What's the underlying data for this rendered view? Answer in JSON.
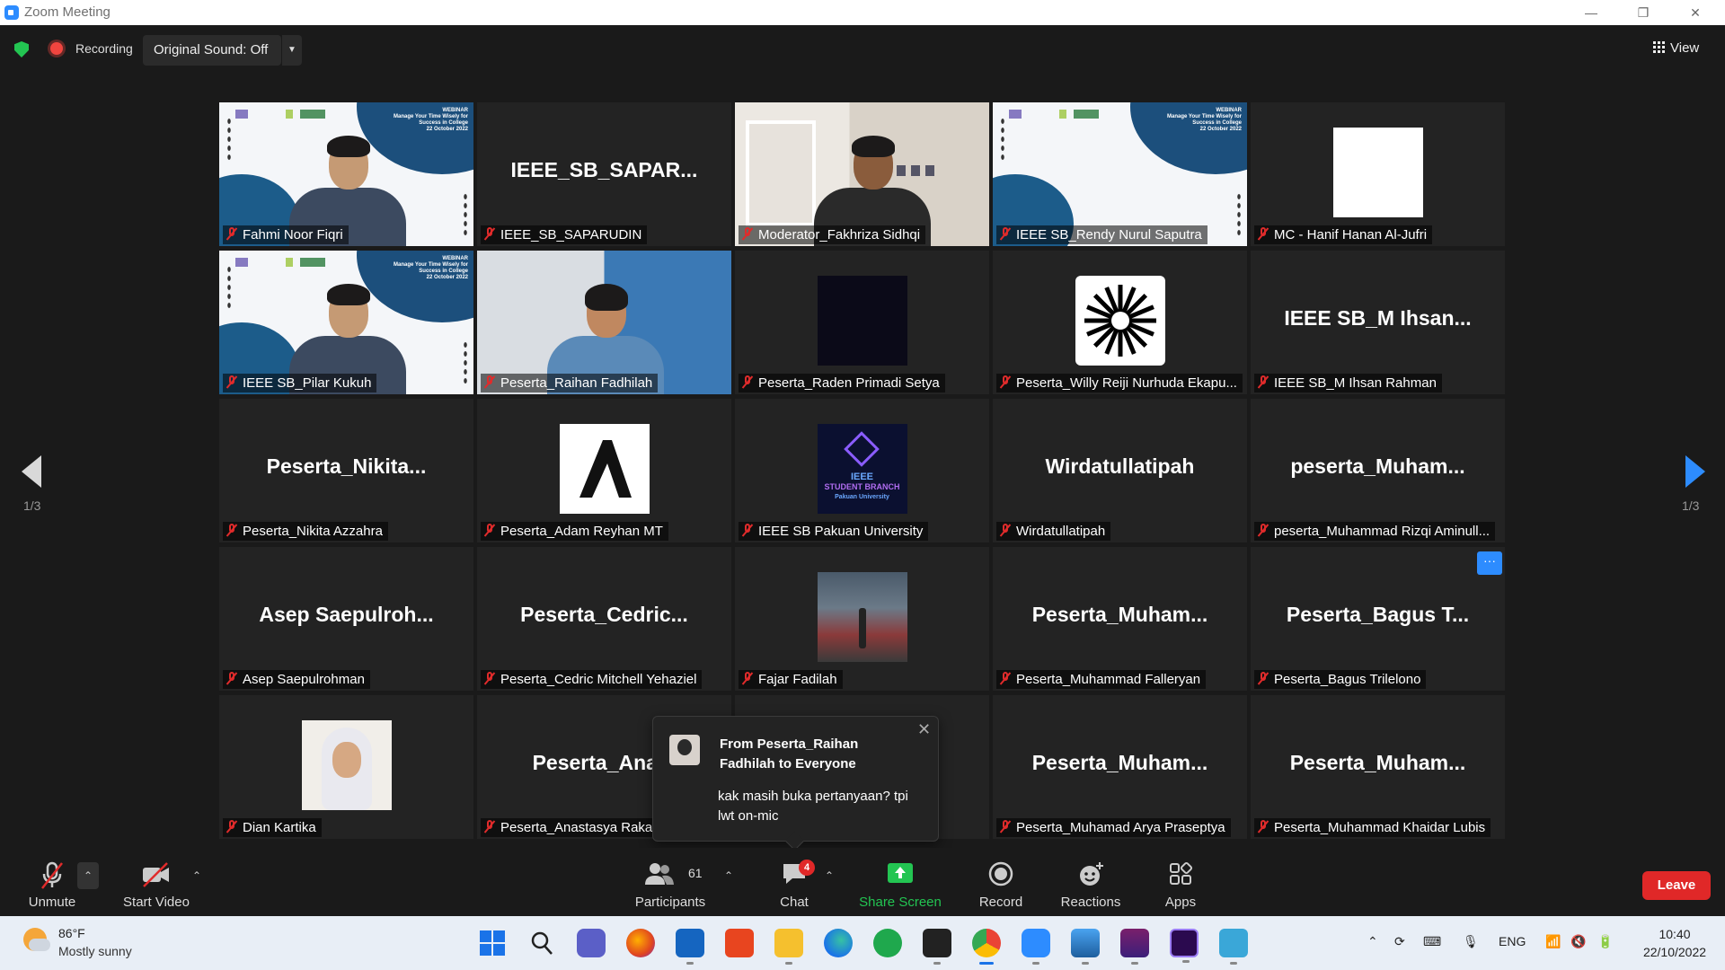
{
  "window": {
    "title": "Zoom Meeting"
  },
  "topbar": {
    "recording_label": "Recording",
    "original_sound_label": "Original Sound: Off",
    "view_label": "View"
  },
  "pagination": {
    "left": "1/3",
    "right": "1/3"
  },
  "participants": [
    {
      "label": "Fahmi Noor Fiqri",
      "type": "slide-video",
      "active": true
    },
    {
      "label": "IEEE_SB_SAPARUDIN",
      "big": "IEEE_SB_SAPAR...",
      "type": "name"
    },
    {
      "label": "Moderator_Fakhriza Sidhqi",
      "type": "video-room"
    },
    {
      "label": "IEEE SB_Rendy Nurul Saputra",
      "type": "slide"
    },
    {
      "label": "MC - Hanif Hanan Al-Jufri",
      "type": "white-avatar"
    },
    {
      "label": "IEEE SB_Pilar Kukuh",
      "type": "slide-video"
    },
    {
      "label": "Peserta_Raihan Fadhilah",
      "type": "video-blue"
    },
    {
      "label": "Peserta_Raden Primadi Setya",
      "type": "dark-avatar"
    },
    {
      "label": "Peserta_Willy Reiji Nurhuda Ekapu...",
      "type": "burst-avatar"
    },
    {
      "label": "IEEE SB_M Ihsan Rahman",
      "big": "IEEE SB_M Ihsan...",
      "type": "name"
    },
    {
      "label": "Peserta_Nikita Azzahra",
      "big": "Peserta_Nikita...",
      "type": "name"
    },
    {
      "label": "Peserta_Adam Reyhan MT",
      "type": "a-avatar"
    },
    {
      "label": "IEEE SB Pakuan University",
      "type": "ieee-avatar",
      "avatar_line1": "IEEE",
      "avatar_line2": "STUDENT BRANCH",
      "avatar_line3": "Pakuan University"
    },
    {
      "label": "Wirdatullatipah",
      "big": "Wirdatullatipah",
      "type": "name"
    },
    {
      "label": "peserta_Muhammad Rizqi Aminull...",
      "big": "peserta_Muham...",
      "type": "name"
    },
    {
      "label": "Asep Saepulrohman",
      "big": "Asep Saepulroh...",
      "type": "name"
    },
    {
      "label": "Peserta_Cedric Mitchell Yehaziel",
      "big": "Peserta_Cedric...",
      "type": "name"
    },
    {
      "label": "Fajar Fadilah",
      "type": "garage-avatar"
    },
    {
      "label": "Peserta_Muhammad Falleryan",
      "big": "Peserta_Muham...",
      "type": "name"
    },
    {
      "label": "Peserta_Bagus Trilelono",
      "big": "Peserta_Bagus T...",
      "type": "name"
    },
    {
      "label": "Dian Kartika",
      "type": "hijab-avatar"
    },
    {
      "label": "Peserta_Anastasya Raka",
      "big": "Peserta_Anast",
      "type": "name"
    },
    {
      "label": "",
      "big": "...",
      "type": "name"
    },
    {
      "label": "Peserta_Muhamad Arya Praseptya",
      "big": "Peserta_Muham...",
      "type": "name"
    },
    {
      "label": "Peserta_Muhammad Khaidar Lubis",
      "big": "Peserta_Muham...",
      "type": "name"
    }
  ],
  "slide": {
    "line1": "WEBINAR",
    "line2": "Manage Your Time Wisely for Success in College",
    "line3": "22 October 2022"
  },
  "chat_popup": {
    "from": "From Peserta_Raihan Fadhilah to Everyone",
    "message": "kak masih buka pertanyaan? tpi lwt on-mic"
  },
  "more_button_label": "···",
  "toolbar": {
    "unmute": "Unmute",
    "start_video": "Start Video",
    "participants": "Participants",
    "participants_count": "61",
    "chat": "Chat",
    "chat_badge": "4",
    "share_screen": "Share Screen",
    "record": "Record",
    "reactions": "Reactions",
    "apps": "Apps",
    "leave": "Leave"
  },
  "taskbar": {
    "temperature": "86°F",
    "weather": "Mostly sunny",
    "language": "ENG",
    "time": "10:40",
    "date": "22/10/2022"
  },
  "colors": {
    "active_speaker": "#bfea3c",
    "accent": "#2d8cff",
    "muted": "#e02b2b",
    "share_green": "#23c552",
    "leave_red": "#e02828"
  }
}
